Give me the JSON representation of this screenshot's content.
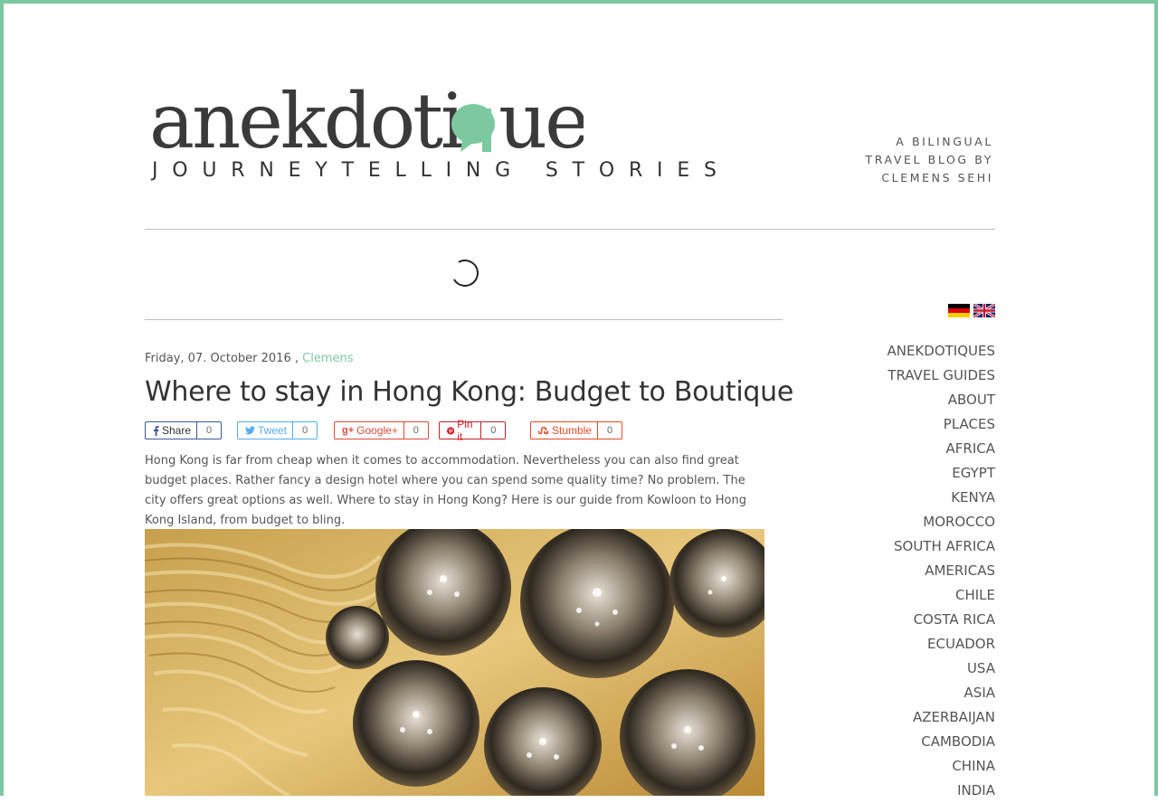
{
  "site": {
    "logo_text": "anekdotique",
    "logo_subtitle": "JOURNEYTELLING STORIES",
    "tagline": [
      "A BILINGUAL",
      "TRAVEL BLOG BY",
      "CLEMENS SEHI"
    ],
    "accent_color": "#7cc9a1"
  },
  "languages": [
    {
      "icon": "german-flag-icon"
    },
    {
      "icon": "uk-flag-icon"
    }
  ],
  "post": {
    "date": "Friday, 07. October 2016 ,",
    "author": "Clemens",
    "title": "Where to stay in Hong Kong: Budget to Boutique",
    "intro": "Hong Kong is far from cheap when it comes to accommodation. Nevertheless you can also find great budget places. Rather fancy a design hotel where you can spend some quality time? No problem. The city offers great options as well. Where to stay in Hong Kong? Here is our guide from Kowloon to Hong Kong Island, from budget to bling."
  },
  "share_buttons": [
    {
      "label": "Share",
      "count": "0",
      "icon": "facebook-icon",
      "color": "#3b5998"
    },
    {
      "label": "Tweet",
      "count": "0",
      "icon": "twitter-icon",
      "color": "#55acee"
    },
    {
      "label": "Google+",
      "count": "0",
      "icon": "google-plus-icon",
      "color": "#dd4b39"
    },
    {
      "label": "Pin it",
      "count": "0",
      "icon": "pinterest-icon",
      "color": "#cb2027"
    },
    {
      "label": "Stumble",
      "count": "0",
      "icon": "stumbleupon-icon",
      "color": "#eb4924"
    }
  ],
  "nav": [
    "ANEKDOTIQUES",
    "TRAVEL GUIDES",
    "ABOUT",
    "PLACES",
    "AFRICA",
    "EGYPT",
    "KENYA",
    "MOROCCO",
    "SOUTH AFRICA",
    "AMERICAS",
    "CHILE",
    "COSTA RICA",
    "ECUADOR",
    "USA",
    "ASIA",
    "AZERBAIJAN",
    "CAMBODIA",
    "CHINA",
    "INDIA"
  ]
}
